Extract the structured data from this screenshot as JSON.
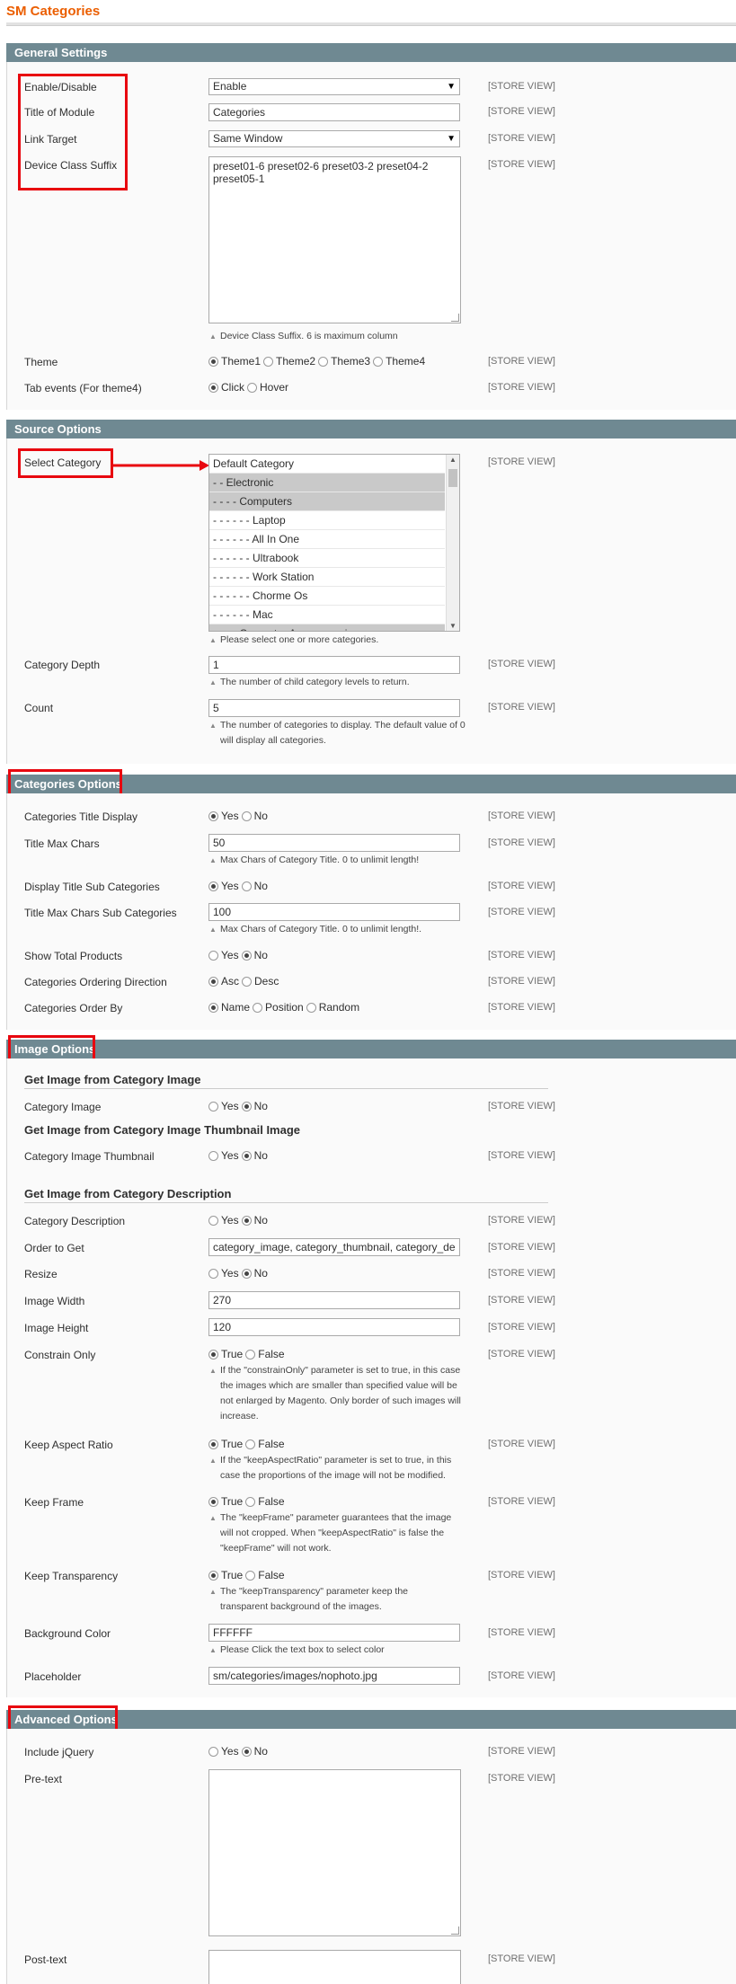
{
  "page": {
    "title": "SM Categories"
  },
  "scope_label": "[STORE VIEW]",
  "general": {
    "header": "General Settings",
    "enable_label": "Enable/Disable",
    "enable_value": "Enable",
    "title_label": "Title of Module",
    "title_value": "Categories",
    "link_target_label": "Link Target",
    "link_target_value": "Same Window",
    "device_label": "Device Class Suffix",
    "device_value": "preset01-6 preset02-6 preset03-2 preset04-2 preset05-1",
    "device_note": "Device Class Suffix. 6 is maximum column",
    "theme_label": "Theme",
    "theme_options": [
      "Theme1",
      "Theme2",
      "Theme3",
      "Theme4"
    ],
    "tab_label": "Tab events (For theme4)",
    "tab_options": [
      "Click",
      "Hover"
    ]
  },
  "source": {
    "header": "Source Options",
    "select_label": "Select Category",
    "categories": [
      "Default Category",
      "- - Electronic",
      "- - - - Computers",
      "- - - - - - Laptop",
      "- - - - - - All In One",
      "- - - - - - Ultrabook",
      "- - - - - - Work Station",
      "- - - - - - Chorme Os",
      "- - - - - - Mac",
      "- - - - Computer Accessosories"
    ],
    "select_note": "Please select one or more categories.",
    "depth_label": "Category Depth",
    "depth_value": "1",
    "depth_note": "The number of child category levels to return.",
    "count_label": "Count",
    "count_value": "5",
    "count_note": "The number of categories to display. The default value of 0 will display all categories."
  },
  "categories": {
    "header": "Categories Options",
    "title_display_label": "Categories Title Display",
    "title_max_label": "Title Max Chars",
    "title_max_value": "50",
    "title_max_note": "Max Chars of Category Title. 0 to unlimit length!",
    "display_sub_label": "Display Title Sub Categories",
    "sub_max_label": "Title Max Chars Sub Categories",
    "sub_max_value": "100",
    "sub_max_note": "Max Chars of Category Title. 0 to unlimit length!.",
    "show_total_label": "Show Total Products",
    "ordering_label": "Categories Ordering Direction",
    "ordering_options": [
      "Asc",
      "Desc"
    ],
    "order_by_label": "Categories Order By",
    "order_by_options": [
      "Name",
      "Position",
      "Random"
    ]
  },
  "yes_no": [
    "Yes",
    "No"
  ],
  "true_false": [
    "True",
    "False"
  ],
  "image": {
    "header": "Image Options",
    "sub1": "Get Image from Category Image",
    "cat_image_label": "Category Image",
    "sub2": "Get Image from Category Image Thumbnail Image",
    "cat_thumb_label": "Category Image Thumbnail",
    "sub3": "Get Image from Category Description",
    "cat_desc_label": "Category Description",
    "order_label": "Order to Get",
    "order_value": "category_image, category_thumbnail, category_de",
    "resize_label": "Resize",
    "width_label": "Image Width",
    "width_value": "270",
    "height_label": "Image Height",
    "height_value": "120",
    "constrain_label": "Constrain Only",
    "constrain_note": "If the \"constrainOnly\" parameter is set to true, in this case the images which are smaller than specified value will be not enlarged by Magento. Only border of such images will increase.",
    "aspect_label": "Keep Aspect Ratio",
    "aspect_note": "If the \"keepAspectRatio\" parameter is set to true, in this case the proportions of the image will not be modified.",
    "frame_label": "Keep Frame",
    "frame_note": "The \"keepFrame\" parameter guarantees that the image will not cropped. When \"keepAspectRatio\" is false the \"keepFrame\" will not work.",
    "transparency_label": "Keep Transparency",
    "transparency_note": "The \"keepTransparency\" parameter keep the transparent background of the images.",
    "bg_label": "Background Color",
    "bg_value": "FFFFFF",
    "bg_note": "Please Click the text box to select color",
    "placeholder_label": "Placeholder",
    "placeholder_value": "sm/categories/images/nophoto.jpg"
  },
  "advanced": {
    "header": "Advanced Options",
    "jquery_label": "Include jQuery",
    "pretext_label": "Pre-text",
    "posttext_label": "Post-text"
  },
  "colors": {
    "title": "#eb5e00",
    "section_header": "#6f8992",
    "highlight": "#e8070f"
  }
}
